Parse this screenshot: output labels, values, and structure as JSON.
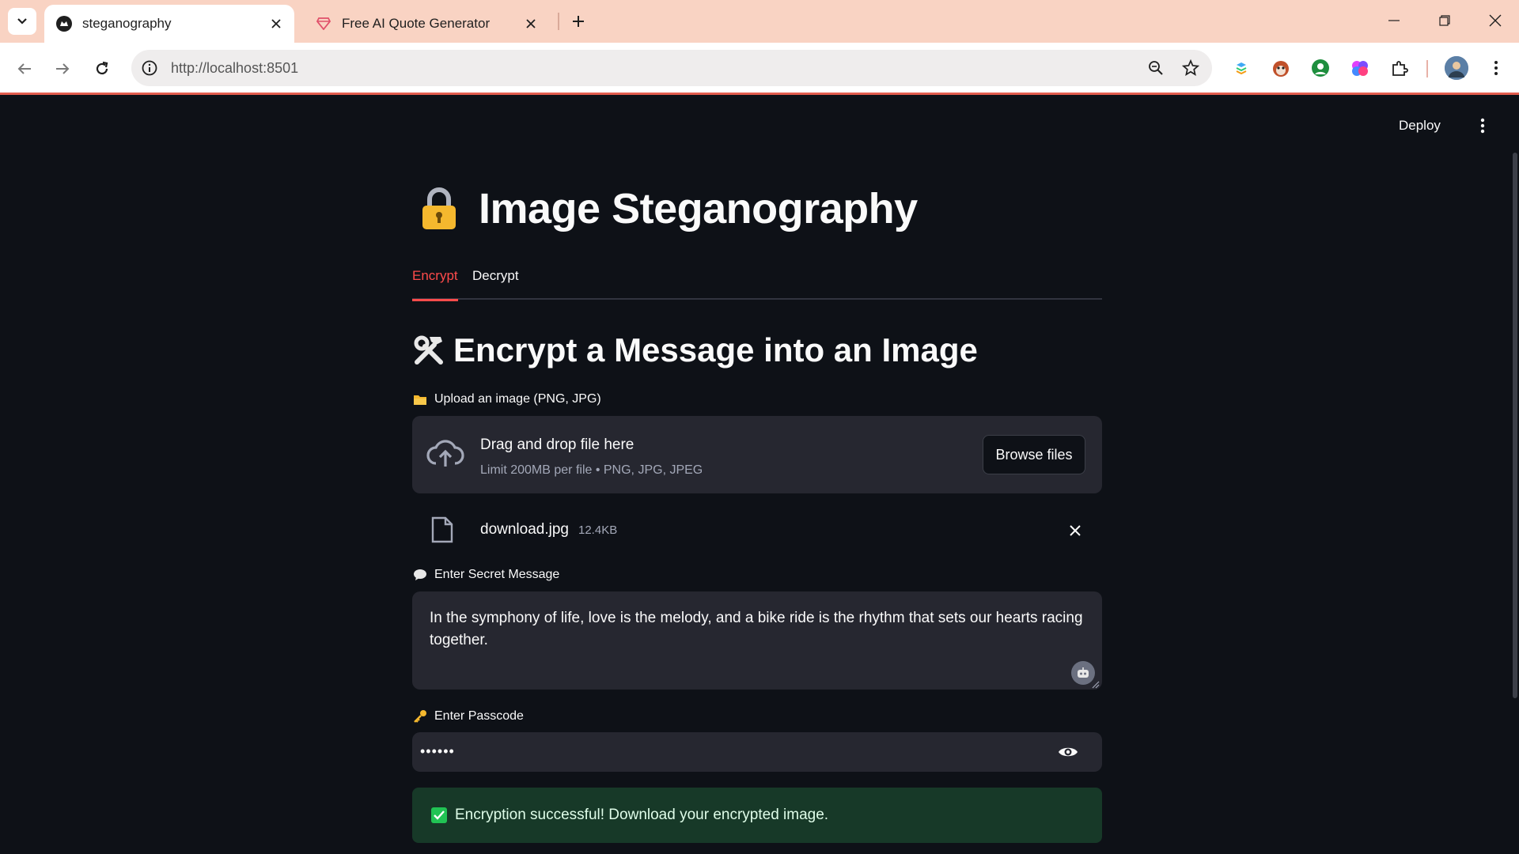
{
  "browser": {
    "tabs": [
      {
        "title": "steganography",
        "active": true
      },
      {
        "title": "Free AI Quote Generator",
        "active": false
      }
    ],
    "url": "http://localhost:8501"
  },
  "app": {
    "deploy_label": "Deploy",
    "title": "Image Steganography",
    "tabs": [
      "Encrypt",
      "Decrypt"
    ],
    "section_title": "Encrypt a Message into an Image",
    "upload": {
      "label": "Upload an image (PNG, JPG)",
      "drop_text": "Drag and drop file here",
      "limit_text": "Limit 200MB per file • PNG, JPG, JPEG",
      "browse_label": "Browse files"
    },
    "file": {
      "name": "download.jpg",
      "size": "12.4KB"
    },
    "message": {
      "label": "Enter Secret Message",
      "value": "In the symphony of life, love is the melody, and a bike ride is the rhythm that sets our hearts racing together."
    },
    "passcode": {
      "label": "Enter Passcode",
      "value": "••••••"
    },
    "success": "Encryption successful! Download your encrypted image."
  },
  "colors": {
    "accent": "#ff4b4b",
    "background": "#0e1117",
    "input_bg": "#262730",
    "success_bg": "#173928"
  }
}
